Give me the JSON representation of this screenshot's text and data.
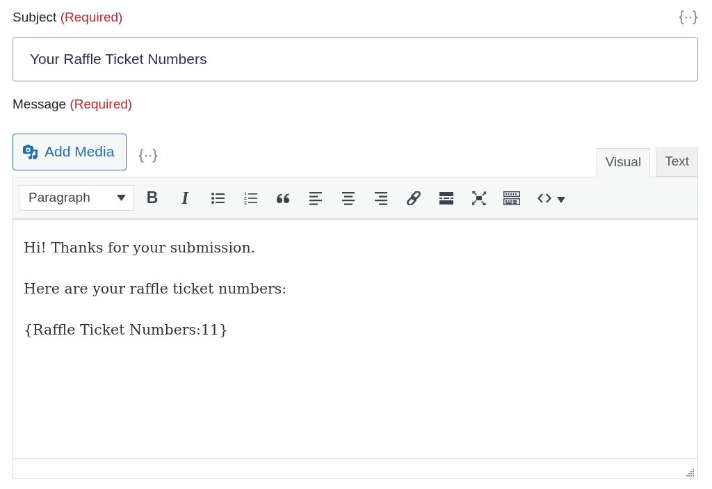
{
  "subject": {
    "label": "Subject",
    "required_note": "(Required)",
    "value": "Your Raffle Ticket Numbers"
  },
  "message": {
    "label": "Message",
    "required_note": "(Required)",
    "add_media_button": "Add Media",
    "tabs": [
      {
        "label": "Visual",
        "selected": true
      },
      {
        "label": "Text",
        "selected": false
      }
    ],
    "format_select": {
      "value": "Paragraph"
    },
    "toolbar": [
      {
        "kind": "bold",
        "glyph": "B"
      },
      {
        "kind": "italic",
        "glyph": "I"
      },
      {
        "kind": "bullet_list"
      },
      {
        "kind": "numbered_list"
      },
      {
        "kind": "quote"
      },
      {
        "kind": "align_left"
      },
      {
        "kind": "align_center"
      },
      {
        "kind": "align_right"
      },
      {
        "kind": "link"
      },
      {
        "kind": "read_more"
      },
      {
        "kind": "fullscreen"
      },
      {
        "kind": "toolbar_toggle"
      },
      {
        "kind": "code"
      }
    ],
    "body": [
      "Hi! Thanks for your submission.",
      "Here are your raffle ticket numbers:",
      "{Raffle Ticket Numbers:11}"
    ]
  }
}
